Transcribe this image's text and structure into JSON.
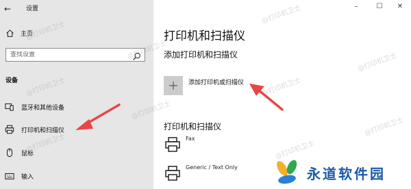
{
  "window": {
    "title": "设置",
    "minimize": "–",
    "maximize": "☐",
    "close": "✕"
  },
  "sidebar": {
    "back": "←",
    "home_label": "主页",
    "search_placeholder": "查找设置",
    "section_label": "设备",
    "items": [
      {
        "label": "蓝牙和其他设备",
        "icon": "bluetooth-devices-icon"
      },
      {
        "label": "打印机和扫描仪",
        "icon": "printer-icon",
        "selected": true
      },
      {
        "label": "鼠标",
        "icon": "mouse-icon"
      },
      {
        "label": "输入",
        "icon": "keyboard-icon"
      }
    ]
  },
  "main": {
    "title": "打印机和扫描仪",
    "add_section_title": "添加打印机和扫描仪",
    "add_button_label": "添加打印机或扫描仪",
    "printers_heading": "打印机和扫描仪",
    "printers": [
      {
        "name": "Fax"
      },
      {
        "name": "Generic / Text Only"
      }
    ]
  },
  "watermark": "@打印机卫士",
  "logo": {
    "text": "永道软件园"
  },
  "colors": {
    "sidebar_bg": "#e6e6e6",
    "arrow": "#e84545",
    "logo_text": "#1a5aa6"
  }
}
